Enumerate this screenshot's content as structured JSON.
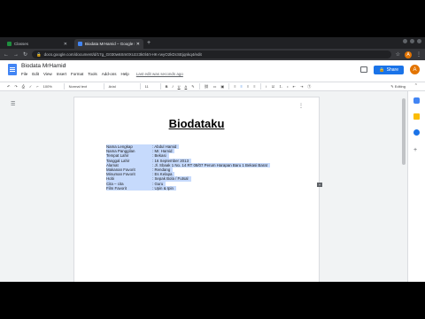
{
  "browser": {
    "tabs": [
      {
        "title": "Classes",
        "favicon_color": "#1e8e3e"
      },
      {
        "title": "Biodata MrHamid – Google Do",
        "favicon_color": "#4285f4"
      }
    ],
    "new_tab": "+",
    "url": "docs.google.com/document/d/17g_G030w6Sm0XUzz3k0l4rt-HK-rwyO2kDcSEjqnkq4/edit",
    "avatar_initial": "A"
  },
  "docs": {
    "title": "Biodata MrHamid",
    "menus": [
      "File",
      "Edit",
      "View",
      "Insert",
      "Format",
      "Tools",
      "Add-ons",
      "Help"
    ],
    "last_edit": "Last edit was seconds ago",
    "share_label": "Share",
    "avatar_initial": "A"
  },
  "toolbar": {
    "zoom": "100%",
    "style": "Normal text",
    "font": "Arial",
    "size": "11",
    "bold": "B",
    "italic": "I",
    "underline": "U",
    "text_color": "A",
    "mode": "Editing"
  },
  "document": {
    "heading": "Biodataku",
    "rows": [
      {
        "key": "Nama Lengkap",
        "value": ": Abdul Hamid"
      },
      {
        "key": "Nama Panggilan",
        "value": ": Mr. Hamid"
      },
      {
        "key": "Tempat Lahir",
        "value": ": Bekasi"
      },
      {
        "key": "Tanggal Lahir",
        "value": ": 16 September 2013"
      },
      {
        "key": "Alamat",
        "value": ": Jl. Sbaak 1 No. 14 RT 08/07 Perum Harapan Baru 1 Bekasi Barat"
      },
      {
        "key": "Makanan Favorit",
        "value": ": Rendang"
      },
      {
        "key": "Minuman Favorit",
        "value": ": Es Kelapa"
      },
      {
        "key": "Hobi",
        "value": ": Sepak Bola / Futsal"
      },
      {
        "key": "Cita – cita",
        "value": ": Guru"
      },
      {
        "key": "Film Favorit",
        "value": ": Upin & Ipin"
      }
    ]
  },
  "sidepanel": {
    "icons": [
      "calendar-icon",
      "keep-icon",
      "tasks-icon"
    ],
    "add_label": "+"
  }
}
